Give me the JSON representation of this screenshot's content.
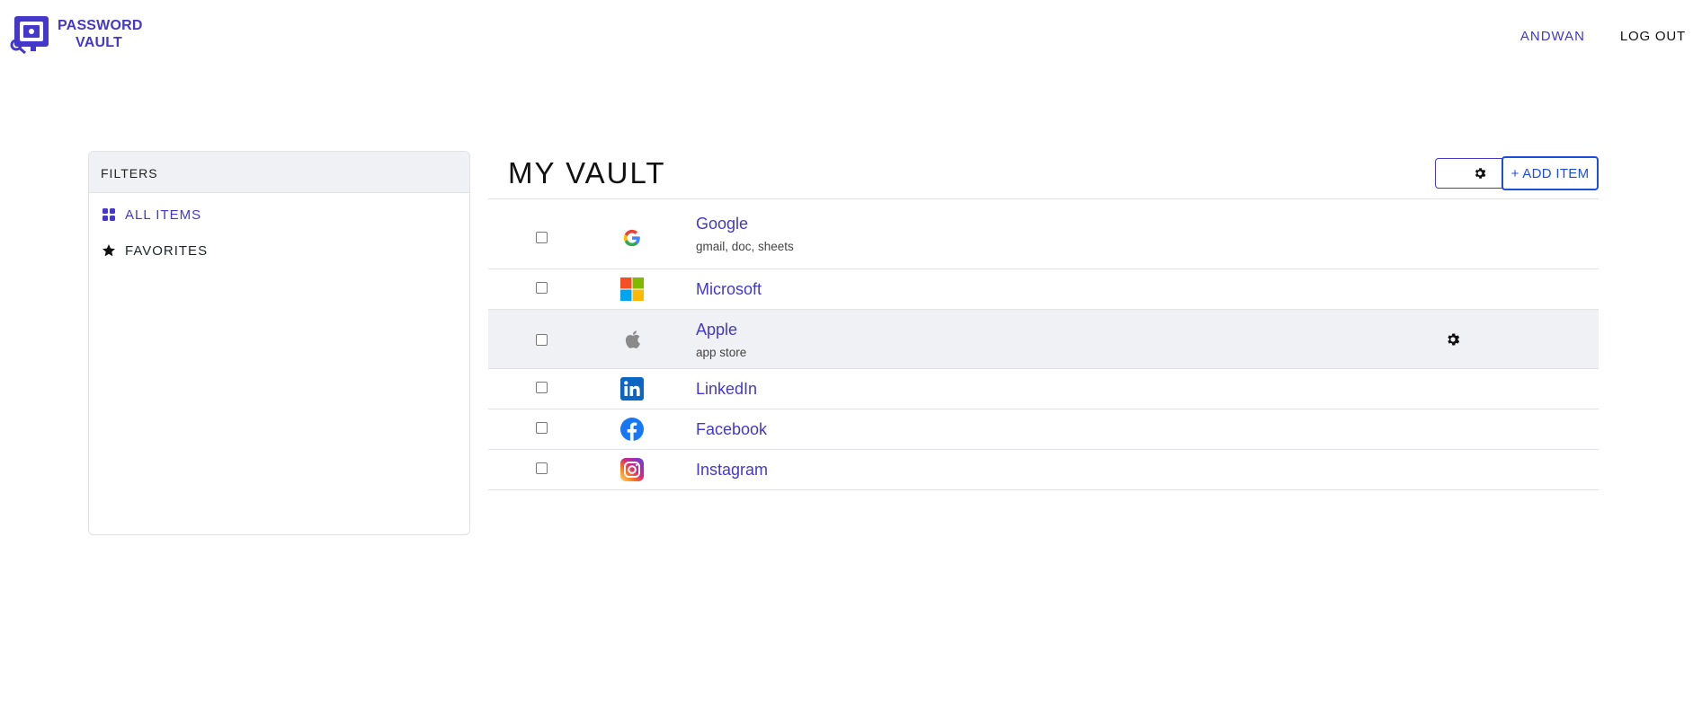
{
  "header": {
    "logo_line1": "PASSWORD",
    "logo_line2": "VAULT",
    "user": "ANDWAN",
    "logout": "LOG OUT"
  },
  "sidebar": {
    "title": "FILTERS",
    "items": [
      {
        "label": "ALL ITEMS",
        "icon": "grid-icon",
        "active": true
      },
      {
        "label": "FAVORITES",
        "icon": "star-icon",
        "active": false
      }
    ]
  },
  "main": {
    "title": "MY VAULT",
    "add_item_label": "+ ADD ITEM",
    "items": [
      {
        "name": "Google",
        "subtitle": "gmail, doc, sheets",
        "icon": "google-logo-icon",
        "checked": false
      },
      {
        "name": "Microsoft",
        "subtitle": "",
        "icon": "microsoft-logo-icon",
        "checked": false
      },
      {
        "name": "Apple",
        "subtitle": "app store",
        "icon": "apple-logo-icon",
        "checked": false,
        "hovered": true
      },
      {
        "name": "LinkedIn",
        "subtitle": "",
        "icon": "linkedin-logo-icon",
        "checked": false
      },
      {
        "name": "Facebook",
        "subtitle": "",
        "icon": "facebook-logo-icon",
        "checked": false
      },
      {
        "name": "Instagram",
        "subtitle": "",
        "icon": "instagram-logo-icon",
        "checked": false
      }
    ]
  },
  "colors": {
    "accent": "#4338ca",
    "add_button": "#1d4ed8",
    "row_hover": "#f0f1f4"
  }
}
